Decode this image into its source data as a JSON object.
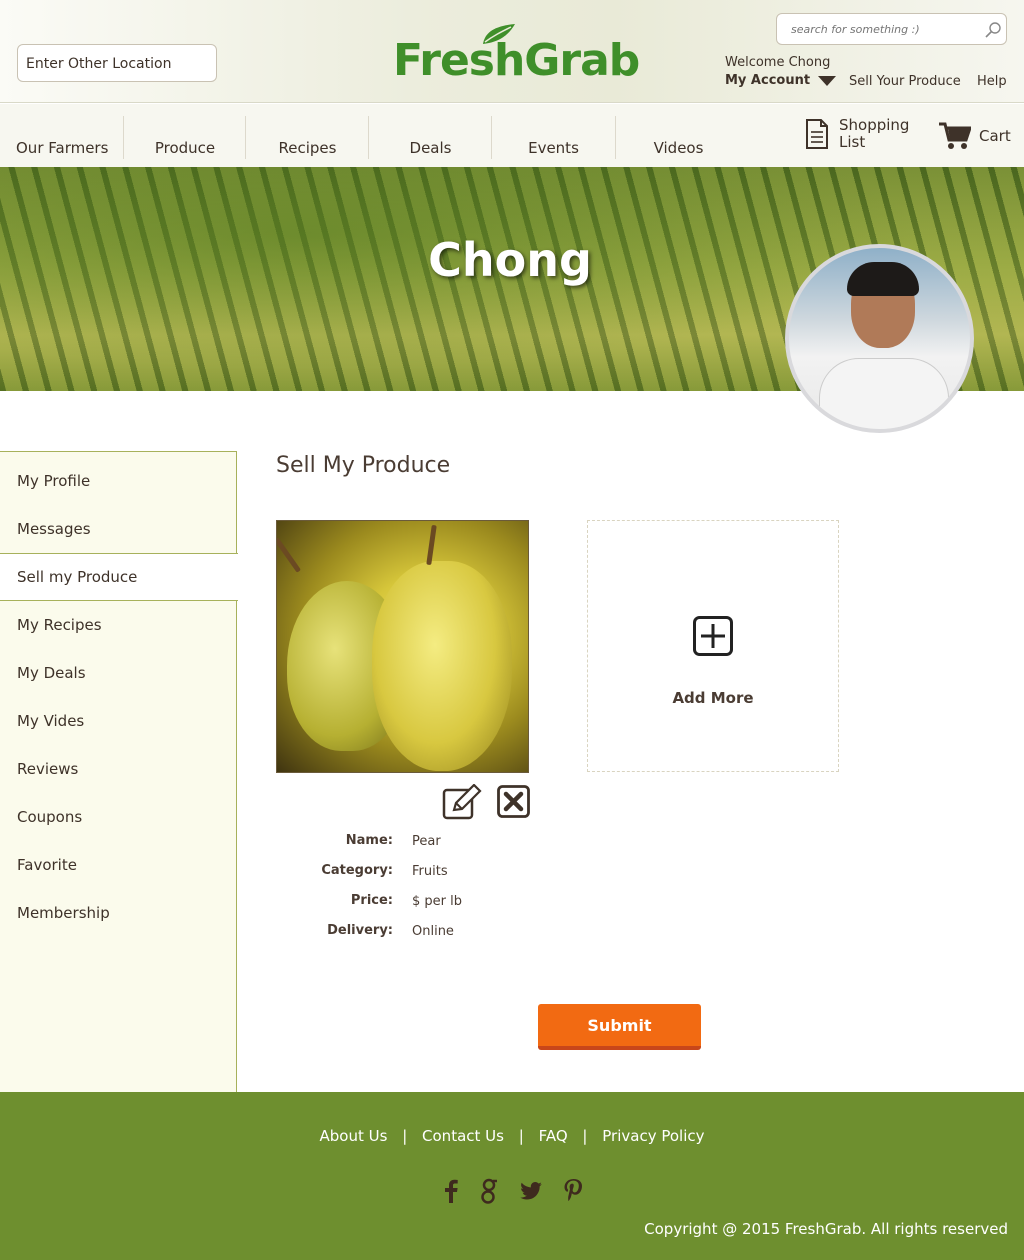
{
  "header": {
    "location_placeholder": "Enter Other Location",
    "logo_text": "FreshGrab",
    "search_placeholder": "search for something :)",
    "welcome": "Welcome Chong",
    "my_account": "My Account",
    "sell_your_produce": "Sell Your Produce",
    "help": "Help"
  },
  "nav": {
    "items": [
      "Our Farmers",
      "Produce",
      "Recipes",
      "Deals",
      "Events",
      "Videos"
    ],
    "shopping_list": "Shopping\nList",
    "cart": "Cart"
  },
  "banner": {
    "name": "Chong"
  },
  "sidebar": {
    "items": [
      "My Profile",
      "Messages",
      "Sell my Produce",
      "My Recipes",
      "My Deals",
      "My Vides",
      "Reviews",
      "Coupons",
      "Favorite",
      "Membership"
    ],
    "active": "Sell my Produce"
  },
  "main": {
    "title": "Sell My Produce",
    "add_more": "Add More",
    "details": {
      "name_label": "Name:",
      "name_value": "Pear",
      "category_label": "Category:",
      "category_value": "Fruits",
      "price_label": "Price:",
      "price_value": "$ per lb",
      "delivery_label": "Delivery:",
      "delivery_value": "Online"
    },
    "submit": "Submit"
  },
  "footer": {
    "links": [
      "About Us",
      "Contact Us",
      "FAQ",
      "Privacy Policy"
    ],
    "separator": "|",
    "social_icons": [
      "facebook-icon",
      "google-icon",
      "twitter-icon",
      "pinterest-icon"
    ],
    "copyright": "Copyright @ 2015 FreshGrab. All rights reserved"
  },
  "colors": {
    "brand_green": "#3f8f2a",
    "footer_green": "#6e8f2f",
    "submit_orange": "#f26a12",
    "sidebar_bg": "#fbfbec"
  }
}
